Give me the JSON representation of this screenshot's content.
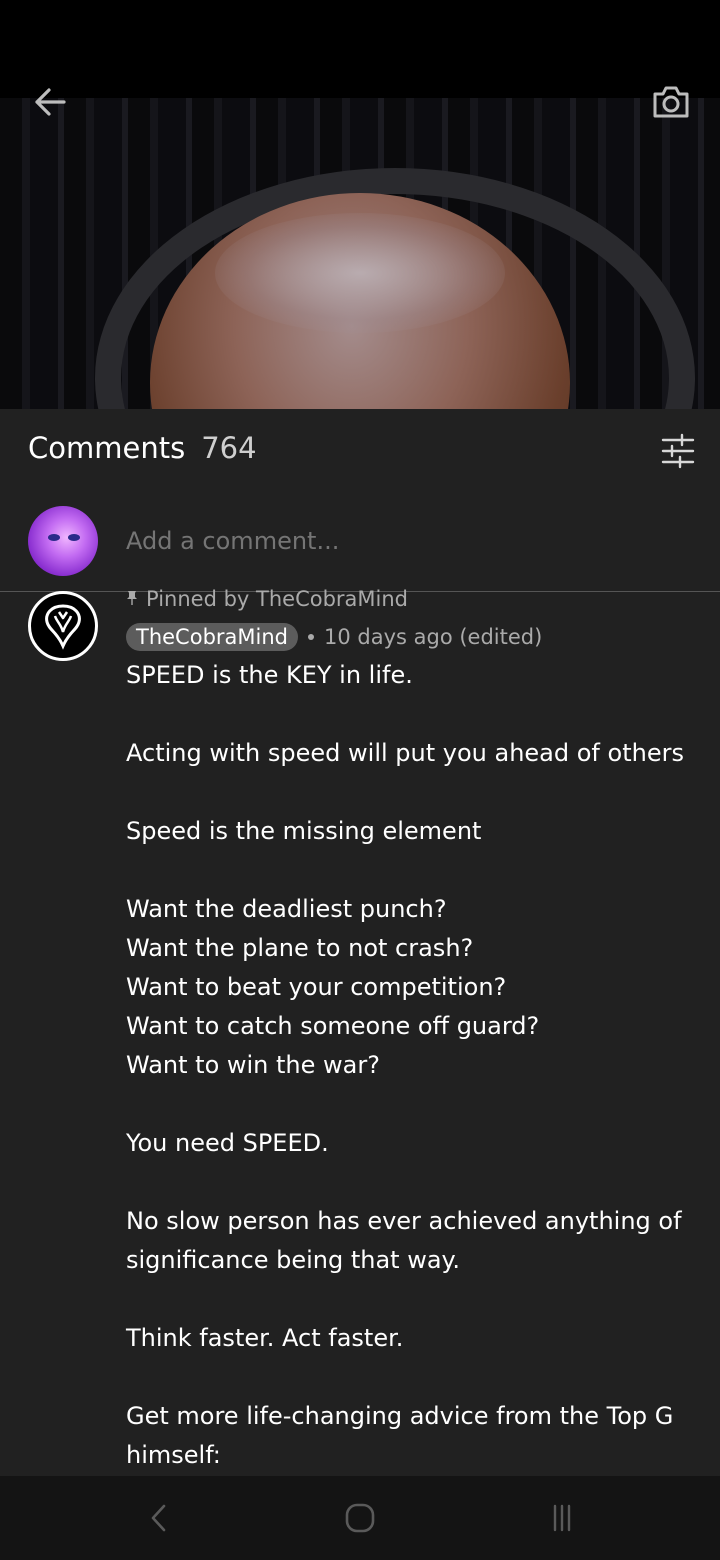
{
  "video": {
    "back_icon": "arrow-left-icon",
    "camera_icon": "camera-icon"
  },
  "comments_header": {
    "title": "Comments",
    "count": "764",
    "filter_icon": "sliders-icon"
  },
  "add_comment": {
    "placeholder": "Add a comment..."
  },
  "pinned_comment": {
    "pinned_label": "Pinned by TheCobraMind",
    "author": "TheCobraMind",
    "timestamp": "10 days ago (edited)",
    "lines": [
      "SPEED is the KEY in life.",
      "",
      "Acting with speed will put you ahead of others",
      "",
      "Speed is the missing element",
      "",
      "Want the deadliest punch?",
      "Want the plane to not crash?",
      "Want to beat your competition?",
      "Want to catch someone off guard?",
      "Want to win the war?",
      "",
      "You need SPEED.",
      "",
      "No slow person has ever achieved anything of",
      "significance being that way.",
      "",
      "Think faster. Act faster.",
      "",
      "Get more life-changing advice from the Top G",
      "himself:"
    ]
  },
  "navbar": {
    "back": "nav-back-icon",
    "home": "nav-home-icon",
    "recent": "nav-recent-apps-icon"
  },
  "colors": {
    "panel_bg": "#212121",
    "navbar_bg": "#141414",
    "author_badge_bg": "#5c5c5c",
    "muted_text": "#aaaaaa"
  }
}
